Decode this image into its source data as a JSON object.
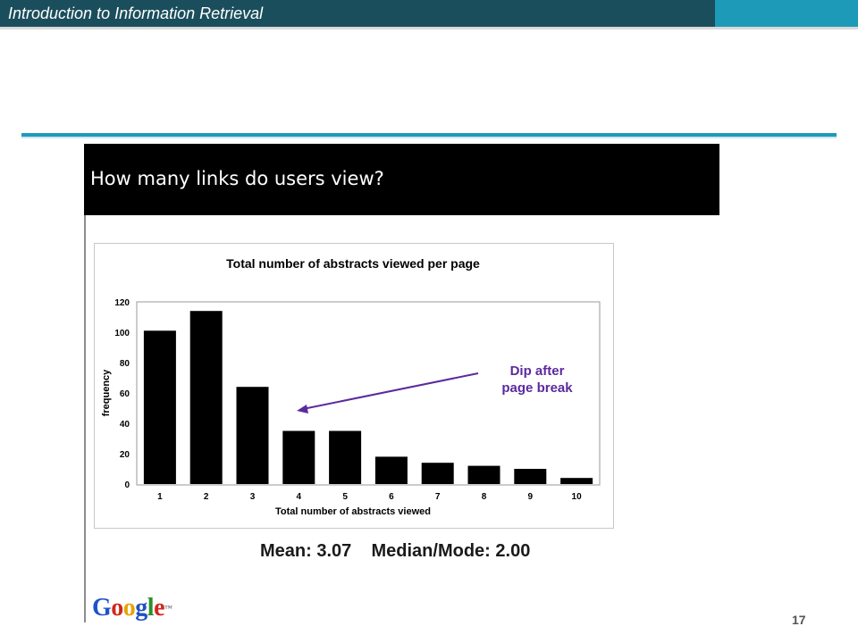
{
  "header": {
    "title": "Introduction to Information Retrieval"
  },
  "figure": {
    "banner_title": "How many links do users view?",
    "stats": {
      "mean": "Mean: 3.07",
      "median_mode": "Median/Mode: 2.00"
    },
    "logo_text": "Google",
    "annotation": {
      "line1": "Dip after",
      "line2": "page break"
    }
  },
  "chart_data": {
    "type": "bar",
    "title": "Total number of abstracts viewed per page",
    "xlabel": "Total number of abstracts viewed",
    "ylabel": "frequency",
    "categories": [
      "1",
      "2",
      "3",
      "4",
      "5",
      "6",
      "7",
      "8",
      "9",
      "10"
    ],
    "values": [
      101,
      114,
      64,
      35,
      35,
      18,
      14,
      12,
      10,
      4
    ],
    "ylim": [
      0,
      120
    ],
    "yticks": [
      0,
      20,
      40,
      60,
      80,
      100,
      120
    ],
    "bar_color": "#000000",
    "annotation_color": "#5b2a9e"
  },
  "footer": {
    "page_number": "17"
  }
}
